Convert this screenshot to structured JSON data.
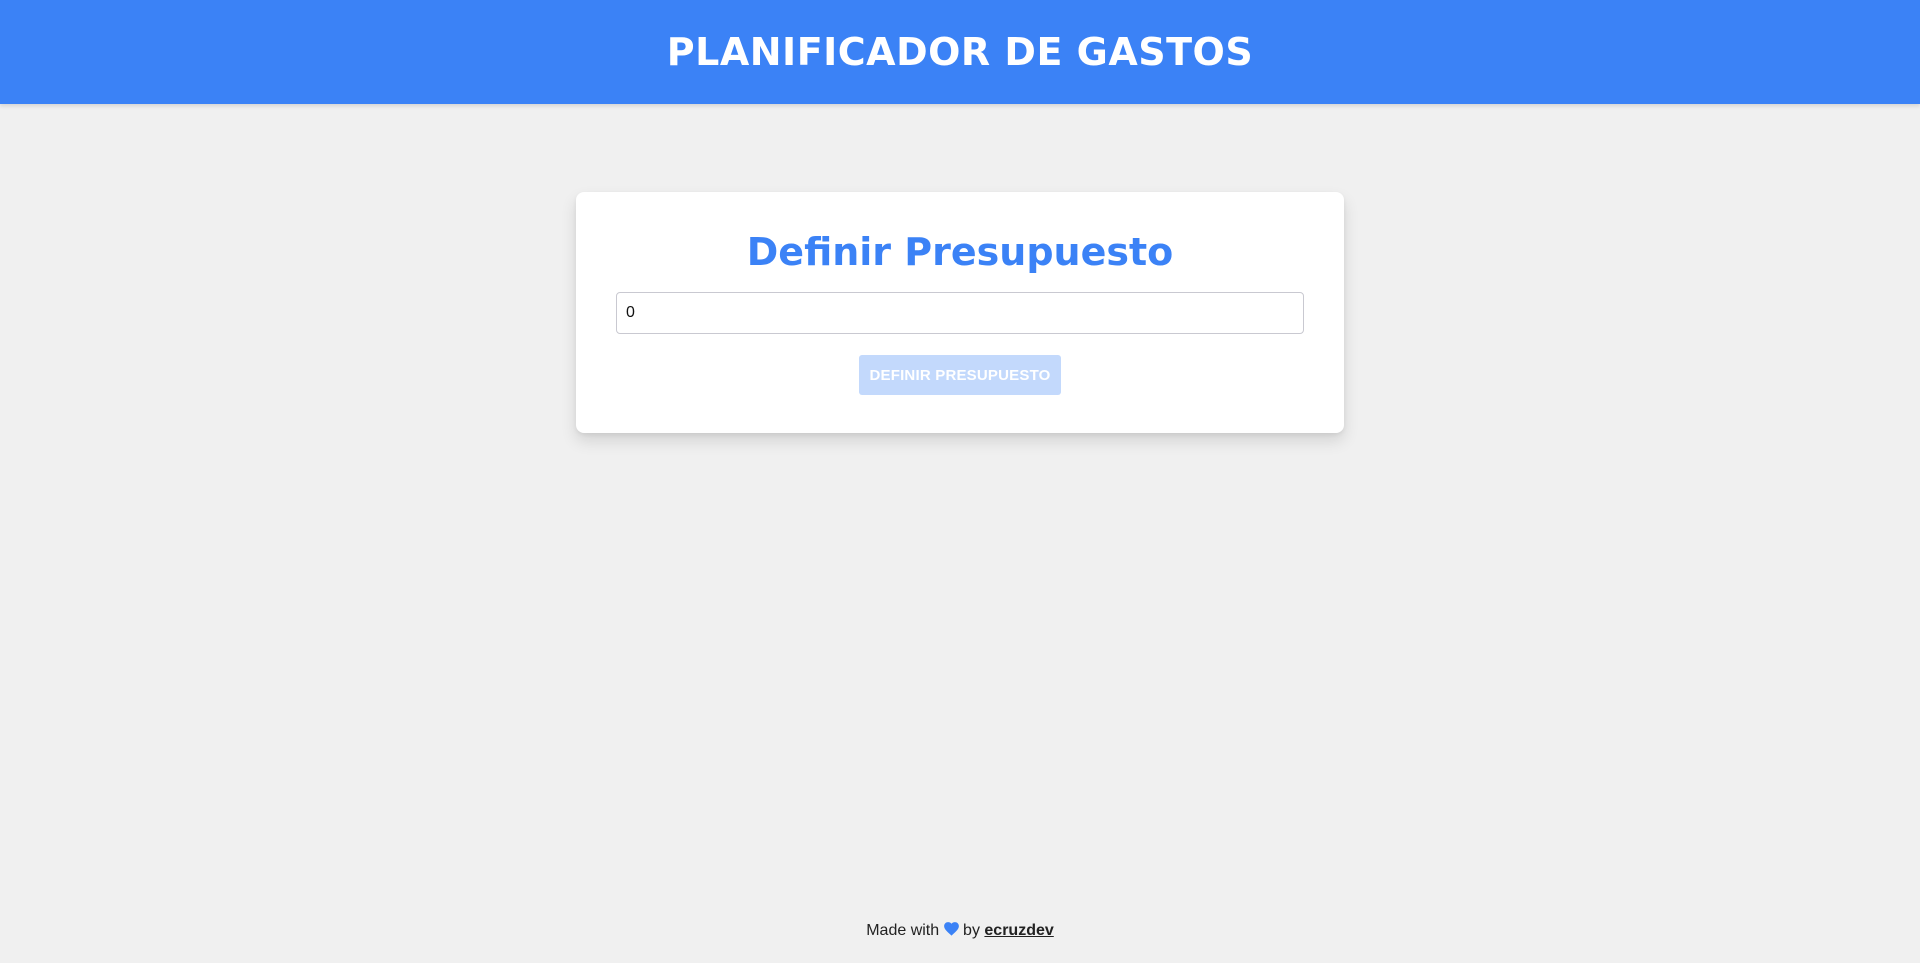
{
  "header": {
    "title": "PLANIFICADOR DE GASTOS"
  },
  "budget_form": {
    "title": "Definir Presupuesto",
    "input_value": "0",
    "submit_label": "DEFINIR PRESUPUESTO",
    "submit_disabled": true
  },
  "footer": {
    "made_with": "Made with",
    "heart_icon": "heart-icon",
    "by": "by",
    "author_link": "ecruzdev"
  },
  "colors": {
    "primary": "#3b82f6",
    "background": "#f0f0f0",
    "button_disabled": "#c3d9fc"
  }
}
